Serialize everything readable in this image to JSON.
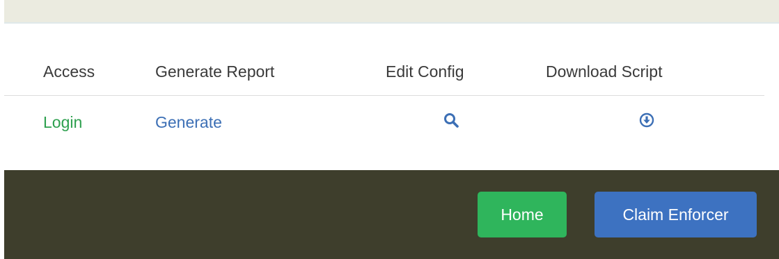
{
  "table": {
    "headers": [
      "Access",
      "Generate Report",
      "Edit Config",
      "Download Script"
    ],
    "row": {
      "access_link": "Login",
      "generate_link": "Generate",
      "edit_icon": "search-icon",
      "download_icon": "download-circle-icon"
    }
  },
  "footer": {
    "home_label": "Home",
    "claim_label": "Claim Enforcer"
  },
  "colors": {
    "login_link": "#2ea04f",
    "generate_link": "#3c6fb5",
    "icon": "#3c6fb5",
    "footer_bg": "#3e3e2c",
    "home_button": "#2fb55c",
    "claim_button": "#3d72c1"
  }
}
